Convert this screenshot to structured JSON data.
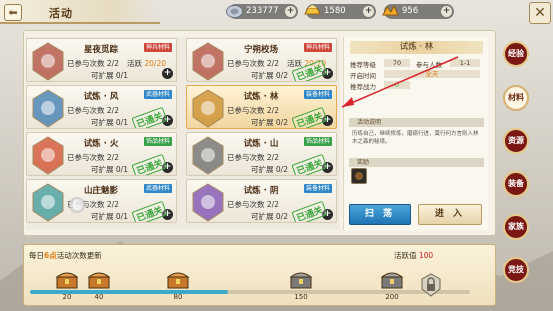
{
  "header": {
    "back_icon": "arrow-left-icon",
    "title": "活动",
    "close_icon": "crossed-swords-icon"
  },
  "currencies": [
    {
      "icon": "silver-coin-icon",
      "value": "233777",
      "color": "#9aa6b3"
    },
    {
      "icon": "gold-ingot-icon",
      "value": "1580",
      "color": "#f0b32a"
    },
    {
      "icon": "gold-pile-icon",
      "value": "956",
      "color": "#f0a020"
    }
  ],
  "cards": [
    {
      "name": "星夜觅踪",
      "tag": "神兵材料",
      "tag_color": "#d0453a",
      "attempts_label": "已参与次数",
      "attempts": "2/2",
      "huoyue_label": "活跃",
      "huoyue": "20/20",
      "expand_label": "可扩展",
      "expand": "0/1",
      "cleared": "",
      "icon": "castle-banner-icon"
    },
    {
      "name": "宁朔校场",
      "tag": "神兵材料",
      "tag_color": "#d0453a",
      "attempts_label": "已参与次数",
      "attempts": "2/2",
      "huoyue_label": "活跃",
      "huoyue": "20/20",
      "expand_label": "可扩展",
      "expand": "0/2",
      "cleared": "已通关",
      "icon": "castle-banner-icon"
    },
    {
      "name": "试炼 · 风",
      "tag": "武器材料",
      "tag_color": "#2f87c9",
      "attempts_label": "已参与次数",
      "attempts": "2/2",
      "huoyue_label": "",
      "huoyue": "",
      "expand_label": "可扩展",
      "expand": "0/1",
      "cleared": "已通关",
      "icon": "wind-spirit-icon"
    },
    {
      "name": "试炼 · 林",
      "tag": "装备材料",
      "tag_color": "#2f87c9",
      "attempts_label": "已参与次数",
      "attempts": "2/2",
      "huoyue_label": "",
      "huoyue": "",
      "expand_label": "可扩展",
      "expand": "0/2",
      "cleared": "已通关",
      "icon": "forest-spirit-icon",
      "selected": true
    },
    {
      "name": "试炼 · 火",
      "tag": "饰品材料",
      "tag_color": "#3aa04a",
      "attempts_label": "已参与次数",
      "attempts": "2/2",
      "huoyue_label": "",
      "huoyue": "",
      "expand_label": "可扩展",
      "expand": "0/1",
      "cleared": "已通关",
      "icon": "fire-spirit-icon"
    },
    {
      "name": "试炼 · 山",
      "tag": "饰品材料",
      "tag_color": "#3aa04a",
      "attempts_label": "已参与次数",
      "attempts": "2/2",
      "huoyue_label": "",
      "huoyue": "",
      "expand_label": "可扩展",
      "expand": "0/2",
      "cleared": "已通关",
      "icon": "mountain-spirit-icon"
    },
    {
      "name": "山庄魅影",
      "tag": "武器材料",
      "tag_color": "#2f87c9",
      "attempts_label": "已参与次数",
      "attempts": "2/2",
      "huoyue_label": "",
      "huoyue": "",
      "expand_label": "可扩展",
      "expand": "0/1",
      "cleared": "已通关",
      "icon": "villa-icon"
    },
    {
      "name": "试炼 · 阴",
      "tag": "装备材料",
      "tag_color": "#2f87c9",
      "attempts_label": "已参与次数",
      "attempts": "2/2",
      "huoyue_label": "",
      "huoyue": "",
      "expand_label": "可扩展",
      "expand": "0/2",
      "cleared": "已通关",
      "icon": "yin-spirit-icon"
    }
  ],
  "detail": {
    "title": "试炼 · 林",
    "rec_level_label": "推荐等级",
    "rec_level": "70",
    "party_label": "参与人数",
    "party": "1-1",
    "open_time_label": "开启时间",
    "open_time": "全天",
    "rec_power_label": "推荐战力",
    "rec_power": "0",
    "desc_header": "活动说明",
    "desc": "历练自己，继续修炼，磨砺行进，莫行何方言则入林木之森的秘境。",
    "reward_header": "奖励",
    "sweep_label": "扫 荡",
    "enter_label": "进 入"
  },
  "side_tabs": [
    "经验",
    "材料",
    "资源",
    "装备",
    "家族",
    "竞技"
  ],
  "side_tab_active": 1,
  "progress": {
    "label_prefix": "每日",
    "label_hour": "6点",
    "label_suffix": "活动次数更新",
    "value_label": "活跃值",
    "value": "100",
    "fill_fraction": 0.45,
    "milestones": [
      {
        "num": "20",
        "opened": true
      },
      {
        "num": "40",
        "opened": true
      },
      {
        "num": "80",
        "opened": true
      },
      {
        "num": "150",
        "opened": false
      },
      {
        "num": "200",
        "opened": false
      }
    ],
    "end_icon": "lock-badge-icon"
  }
}
